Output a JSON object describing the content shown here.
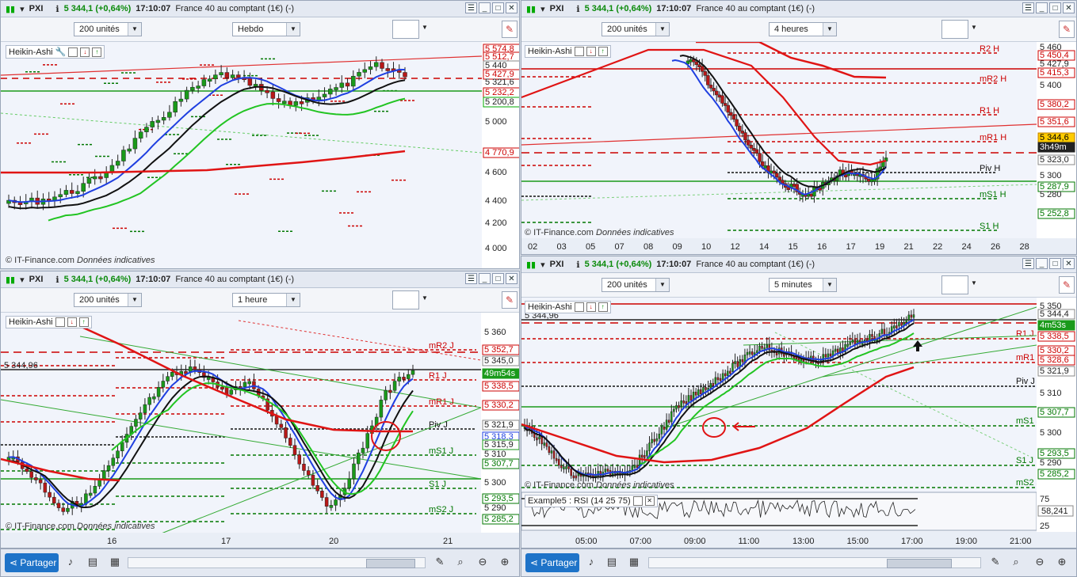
{
  "common": {
    "symbol": "PXI",
    "price": "5 344,1 (+0,64%)",
    "time": "17:10:07",
    "instrument": "France 40 au comptant (1€) (-)",
    "units": "200 unités",
    "indicator": "Heikin-Ashi",
    "copyright": "© IT-Finance.com",
    "copyright_note": "Données indicatives",
    "share": "Partager"
  },
  "panes": {
    "weekly": {
      "period": "Hebdo",
      "y_labels": [
        "5 574,8",
        "5 512,7",
        "5 440",
        "5 427,9",
        "5 321,6",
        "5 232,2",
        "5 200,8",
        "5 000",
        "4 770,9",
        "4 600",
        "4 400",
        "4 200",
        "4 000"
      ]
    },
    "h4": {
      "period": "4 heures",
      "y_labels": [
        "5 460",
        "5 450,4",
        "5 427,9",
        "5 415,3",
        "5 400",
        "5 380,2",
        "5 351,6",
        "5 344,6",
        "3h49m",
        "5 323,0",
        "5 300",
        "5 287,9",
        "5 280",
        "5 252,8"
      ],
      "pivots": [
        "R2 H",
        "mR2 H",
        "R1 H",
        "mR1 H",
        "Piv H",
        "mS1 H",
        "S1 H"
      ],
      "x_labels": [
        "02",
        "03",
        "05",
        "07",
        "08",
        "09",
        "10",
        "12",
        "14",
        "15",
        "16",
        "17",
        "19",
        "21",
        "22",
        "24",
        "26",
        "28"
      ]
    },
    "h1": {
      "period": "1 heure",
      "level_label": "5 344,96",
      "y_labels": [
        "5 360",
        "5 352,7",
        "5 345,0",
        "49m54s",
        "5 338,5",
        "5 330,2",
        "5 321,9",
        "5 318,3",
        "5 315,9",
        "5 310",
        "5 307,7",
        "5 300",
        "5 293,5",
        "5 290",
        "5 285,2"
      ],
      "pivots": [
        "mR2 J",
        "R1 J",
        "mR1 J",
        "Piv J",
        "mS1 J",
        "S1 J",
        "mS2 J"
      ],
      "x_labels": [
        "16",
        "17",
        "20",
        "21"
      ]
    },
    "m5": {
      "period": "5 minutes",
      "level_label": "5 344,96",
      "y_labels": [
        "5 350",
        "5 344,4",
        "4m53s",
        "5 338,5",
        "5 330,2",
        "5 328,6",
        "5 321,9",
        "5 310",
        "5 307,7",
        "5 300",
        "5 293,5",
        "5 290",
        "5 285,2"
      ],
      "pivots": [
        "R1 J",
        "mR1 J",
        "Piv J",
        "mS1 J",
        "S1 J",
        "mS2 J"
      ],
      "x_labels": [
        "05:00",
        "07:00",
        "09:00",
        "11:00",
        "13:00",
        "15:00",
        "17:00",
        "19:00",
        "21:00"
      ],
      "rsi_label": "Example5 : RSI (14 25 75)",
      "rsi_levels": [
        "75",
        "58,241",
        "25"
      ]
    }
  },
  "colors": {
    "up": "#1a9a1a",
    "down": "#b81818",
    "ma_red": "#e01414",
    "ma_blue": "#1f3fe0",
    "ma_green": "#22c422",
    "ma_black": "#111111"
  }
}
